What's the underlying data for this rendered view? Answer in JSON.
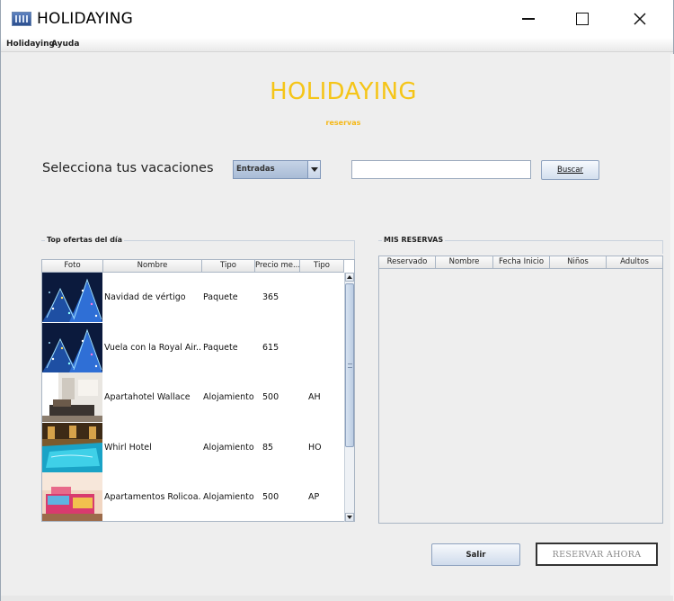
{
  "window": {
    "title": "HOLIDAYING"
  },
  "menu": {
    "items": [
      "Holidaying",
      "Ayuda"
    ]
  },
  "header": {
    "title": "HOLIDAYING",
    "subtitle": "reservas",
    "title_color": "#f5c518"
  },
  "search": {
    "label": "Selecciona tus vacaciones",
    "category_selected": "Entradas",
    "query_value": "",
    "button_label": "Buscar"
  },
  "offers": {
    "title": "Top ofertas del día",
    "columns": [
      "Foto",
      "Nombre",
      "Tipo",
      "Precio me...",
      "Tipo"
    ],
    "rows": [
      {
        "image_icon": "photo-christmas-lights",
        "nombre": "Navidad de vértigo",
        "tipo": "Paquete",
        "precio": "365",
        "codigo": ""
      },
      {
        "image_icon": "photo-christmas-lights",
        "nombre": "Vuela con la Royal Air...",
        "tipo": "Paquete",
        "precio": "615",
        "codigo": ""
      },
      {
        "image_icon": "photo-apartment-interior",
        "nombre": "Apartahotel Wallace",
        "tipo": "Alojamiento",
        "precio": "500",
        "codigo": "AH"
      },
      {
        "image_icon": "photo-hotel-pool",
        "nombre": "Whirl Hotel",
        "tipo": "Alojamiento",
        "precio": "85",
        "codigo": "HO"
      },
      {
        "image_icon": "photo-bedroom",
        "nombre": "Apartamentos Rolicoa...",
        "tipo": "Alojamiento",
        "precio": "500",
        "codigo": "AP"
      }
    ]
  },
  "reservations": {
    "title": "MIS RESERVAS",
    "columns": [
      "Reservado",
      "Nombre",
      "Fecha Inicio",
      "Niños",
      "Adultos"
    ],
    "rows": []
  },
  "actions": {
    "exit_label": "Salir",
    "book_label": "RESERVAR AHORA"
  }
}
